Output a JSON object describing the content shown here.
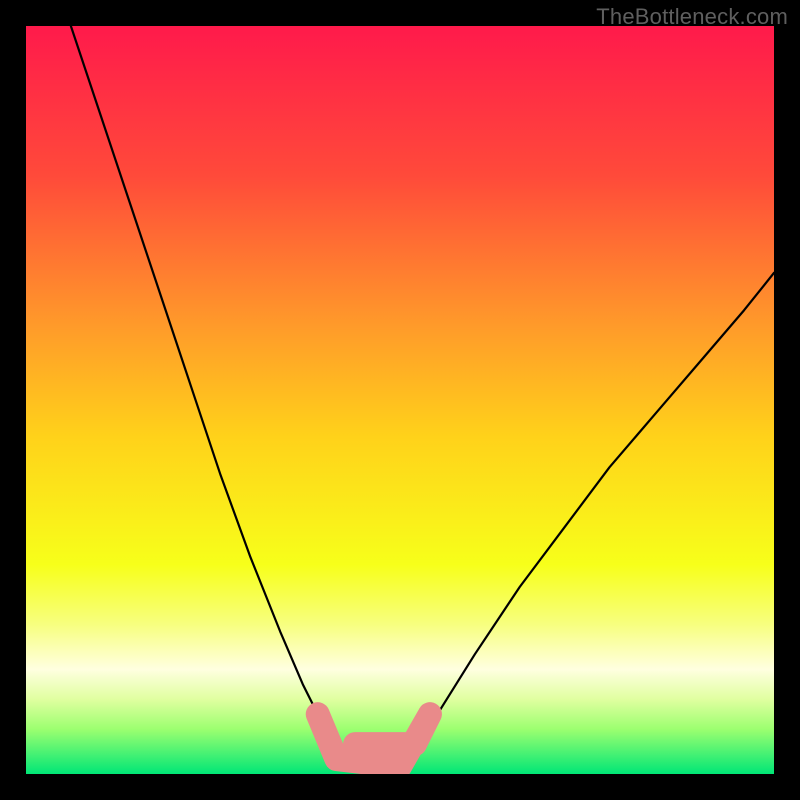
{
  "watermark": "TheBottleneck.com",
  "chart_data": {
    "type": "line",
    "title": "",
    "xlabel": "",
    "ylabel": "",
    "xlim": [
      0,
      100
    ],
    "ylim": [
      0,
      100
    ],
    "grid": false,
    "background": {
      "type": "vertical-gradient",
      "stops": [
        {
          "pos": 0.0,
          "color": "#ff1a4b"
        },
        {
          "pos": 0.2,
          "color": "#ff4a3a"
        },
        {
          "pos": 0.4,
          "color": "#ff9a2a"
        },
        {
          "pos": 0.55,
          "color": "#ffd21a"
        },
        {
          "pos": 0.72,
          "color": "#f7ff1a"
        },
        {
          "pos": 0.8,
          "color": "#f7ff7f"
        },
        {
          "pos": 0.86,
          "color": "#ffffe0"
        },
        {
          "pos": 0.9,
          "color": "#e0ffa0"
        },
        {
          "pos": 0.94,
          "color": "#9cff70"
        },
        {
          "pos": 1.0,
          "color": "#00e676"
        }
      ]
    },
    "annotations": [
      {
        "name": "blob",
        "color": "#e98a8a",
        "alpha": 1.0,
        "points": [
          {
            "x": 39.0,
            "y": 8.0
          },
          {
            "x": 41.5,
            "y": 2.0
          },
          {
            "x": 50.0,
            "y": 1.0
          },
          {
            "x": 54.0,
            "y": 8.0
          },
          {
            "x": 52.0,
            "y": 4.0
          },
          {
            "x": 44.0,
            "y": 4.0
          }
        ]
      }
    ],
    "series": [
      {
        "name": "left-curve",
        "color": "#000000",
        "width": 2.2,
        "x": [
          6,
          10,
          14,
          18,
          22,
          26,
          30,
          34,
          37,
          39,
          41,
          42.5
        ],
        "y": [
          100,
          88,
          76,
          64,
          52,
          40,
          29,
          19,
          12,
          8,
          5,
          2.5
        ]
      },
      {
        "name": "right-curve",
        "color": "#000000",
        "width": 2.2,
        "x": [
          52,
          55,
          60,
          66,
          72,
          78,
          84,
          90,
          96,
          100
        ],
        "y": [
          2.5,
          8,
          16,
          25,
          33,
          41,
          48,
          55,
          62,
          67
        ]
      }
    ]
  }
}
